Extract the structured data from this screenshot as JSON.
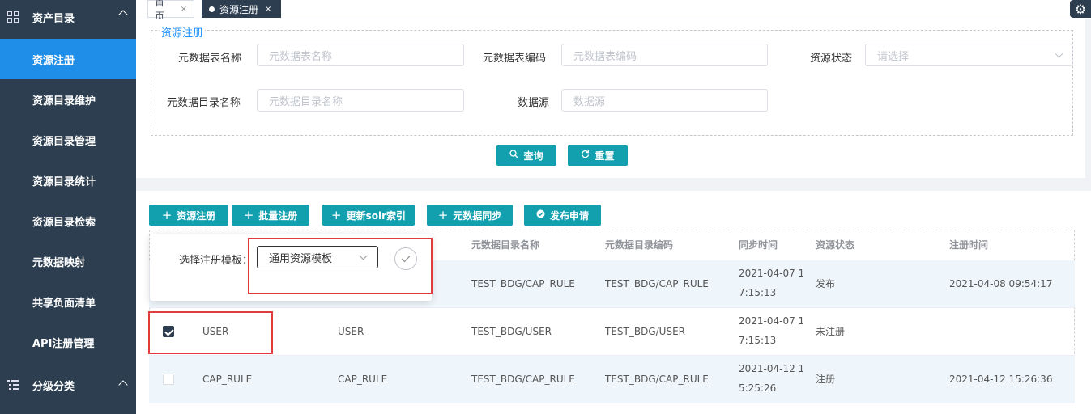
{
  "sidebar": {
    "group1": {
      "icon": "grid-icon",
      "label": "资产目录"
    },
    "items": [
      {
        "label": "资源注册",
        "active": true
      },
      {
        "label": "资源目录维护"
      },
      {
        "label": "资源目录管理"
      },
      {
        "label": "资源目录统计"
      },
      {
        "label": "资源目录检索"
      },
      {
        "label": "元数据映射"
      },
      {
        "label": "共享负面清单"
      },
      {
        "label": "API注册管理"
      }
    ],
    "group2": {
      "icon": "tree-icon",
      "label": "分级分类"
    }
  },
  "tabs": [
    {
      "label": "首页",
      "close": "×"
    },
    {
      "label": "资源注册",
      "close": "×",
      "active": true
    }
  ],
  "search": {
    "legend": "资源注册",
    "fields": {
      "table_name": {
        "label": "元数据表名称",
        "placeholder": "元数据表名称"
      },
      "table_code": {
        "label": "元数据表编码",
        "placeholder": "元数据表编码"
      },
      "status": {
        "label": "资源状态",
        "placeholder": "请选择"
      },
      "catalog_name": {
        "label": "元数据目录名称",
        "placeholder": "元数据目录名称"
      },
      "datasource": {
        "label": "数据源",
        "placeholder": "数据源"
      }
    },
    "query_label": "查询",
    "reset_label": "重置"
  },
  "toolbar": {
    "register": "资源注册",
    "batch": "批量注册",
    "solr": "更新solr索引",
    "sync": "元数据同步",
    "publish": "发布申请"
  },
  "table": {
    "headers": {
      "catalog_name": "元数据目录名称",
      "catalog_code": "元数据目录编码",
      "sync_time": "同步时间",
      "status": "资源状态",
      "reg_time": "注册时间"
    },
    "rows": [
      {
        "name": "",
        "code": "",
        "catalog_name": "TEST_BDG/CAP_RULE",
        "catalog_code": "TEST_BDG/CAP_RULE",
        "sync1": "2021-04-07 1",
        "sync2": "7:15:13",
        "status": "发布",
        "reg_time": "2021-04-08 09:54:17",
        "checked": false
      },
      {
        "name": "USER",
        "code": "USER",
        "catalog_name": "TEST_BDG/USER",
        "catalog_code": "TEST_BDG/USER",
        "sync1": "2021-04-07 1",
        "sync2": "7:15:13",
        "status": "未注册",
        "reg_time": "",
        "checked": true
      },
      {
        "name": "CAP_RULE",
        "code": "CAP_RULE",
        "catalog_name": "TEST_BDG/CAP_RULE",
        "catalog_code": "TEST_BDG/CAP_RULE",
        "sync1": "2021-04-12 1",
        "sync2": "5:25:26",
        "status": "注册",
        "reg_time": "2021-04-12 15:26:36",
        "checked": false
      }
    ]
  },
  "popover": {
    "label": "选择注册模板：",
    "selected": "通用资源模板",
    "confirm_icon": "check-icon"
  },
  "colors": {
    "sidebar": "#2c3e50",
    "active": "#1f8ee8",
    "button": "#12a0ae",
    "highlight": "#e03c3c"
  }
}
